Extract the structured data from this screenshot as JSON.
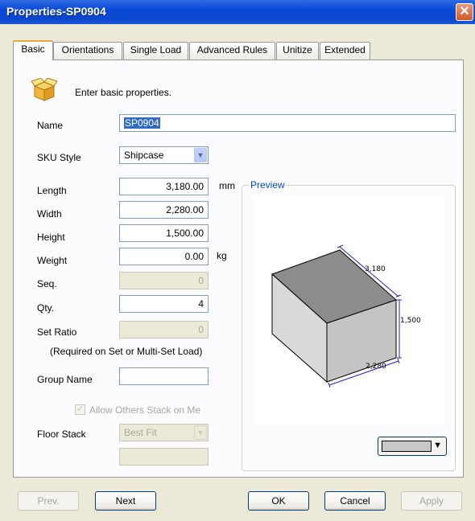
{
  "window": {
    "title": "Properties-SP0904",
    "close_glyph": "✕"
  },
  "tabs": [
    {
      "label": "Basic"
    },
    {
      "label": "Orientations"
    },
    {
      "label": "Single Load"
    },
    {
      "label": "Advanced Rules"
    },
    {
      "label": "Unitize"
    },
    {
      "label": "Extended"
    }
  ],
  "header": {
    "text": "Enter basic properties.",
    "icon": "box-icon"
  },
  "form": {
    "name_label": "Name",
    "name_value": "SP0904",
    "sku_style_label": "SKU Style",
    "sku_style_value": "Shipcase",
    "length_label": "Length",
    "length_value": "3,180.00",
    "length_unit": "mm",
    "width_label": "Width",
    "width_value": "2,280.00",
    "height_label": "Height",
    "height_value": "1,500.00",
    "weight_label": "Weight",
    "weight_value": "0.00",
    "weight_unit": "kg",
    "seq_label": "Seq.",
    "seq_value": "0",
    "qty_label": "Qty.",
    "qty_value": "4",
    "set_ratio_label": "Set Ratio",
    "set_ratio_value": "0",
    "set_ratio_note": "(Required on Set or Multi-Set Load)",
    "group_name_label": "Group Name",
    "group_name_value": "",
    "allow_stack_label": "Allow Others Stack on Me",
    "allow_stack_checked": true,
    "floor_stack_label": "Floor Stack",
    "floor_stack_value": "Best Fit",
    "floor_stack_extra": ""
  },
  "preview": {
    "legend": "Preview",
    "dim_length": "3,180",
    "dim_height": "1,500",
    "dim_width": "2,280",
    "box_color": "#c8c8c8"
  },
  "buttons": {
    "prev": "Prev.",
    "next": "Next",
    "ok": "OK",
    "cancel": "Cancel",
    "apply": "Apply"
  }
}
